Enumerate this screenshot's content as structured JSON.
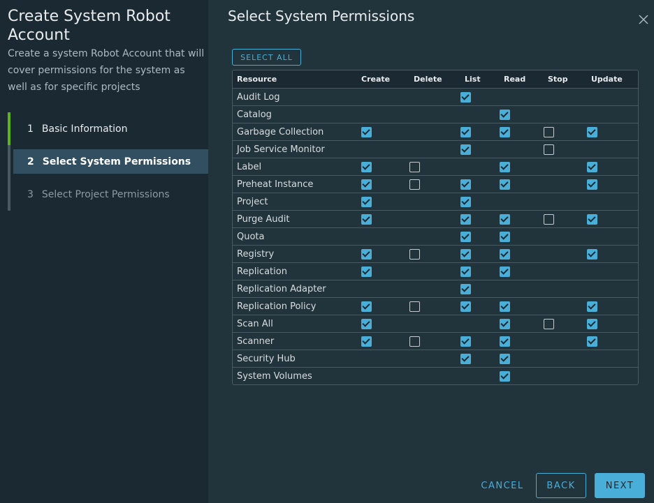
{
  "sidebar": {
    "title": "Create System Robot Account",
    "description": "Create a system Robot Account that will cover permissions for the system as well as for specific projects",
    "steps": [
      {
        "num": "1",
        "label": "Basic Information",
        "state": "done"
      },
      {
        "num": "2",
        "label": "Select System Permissions",
        "state": "active"
      },
      {
        "num": "3",
        "label": "Select Project Permissions",
        "state": "pending"
      }
    ]
  },
  "main": {
    "title": "Select System Permissions",
    "select_all_label": "SELECT ALL"
  },
  "table": {
    "headers": {
      "resource": "Resource",
      "create": "Create",
      "delete": "Delete",
      "list": "List",
      "read": "Read",
      "stop": "Stop",
      "update": "Update"
    },
    "rows": [
      {
        "resource": "Audit Log",
        "create": null,
        "delete": null,
        "list": true,
        "read": null,
        "stop": null,
        "update": null
      },
      {
        "resource": "Catalog",
        "create": null,
        "delete": null,
        "list": null,
        "read": true,
        "stop": null,
        "update": null
      },
      {
        "resource": "Garbage Collection",
        "create": true,
        "delete": null,
        "list": true,
        "read": true,
        "stop": false,
        "update": true
      },
      {
        "resource": "Job Service Monitor",
        "create": null,
        "delete": null,
        "list": true,
        "read": null,
        "stop": false,
        "update": null
      },
      {
        "resource": "Label",
        "create": true,
        "delete": false,
        "list": null,
        "read": true,
        "stop": null,
        "update": true
      },
      {
        "resource": "Preheat Instance",
        "create": true,
        "delete": false,
        "list": true,
        "read": true,
        "stop": null,
        "update": true
      },
      {
        "resource": "Project",
        "create": true,
        "delete": null,
        "list": true,
        "read": null,
        "stop": null,
        "update": null
      },
      {
        "resource": "Purge Audit",
        "create": true,
        "delete": null,
        "list": true,
        "read": true,
        "stop": false,
        "update": true
      },
      {
        "resource": "Quota",
        "create": null,
        "delete": null,
        "list": true,
        "read": true,
        "stop": null,
        "update": null
      },
      {
        "resource": "Registry",
        "create": true,
        "delete": false,
        "list": true,
        "read": true,
        "stop": null,
        "update": true
      },
      {
        "resource": "Replication",
        "create": true,
        "delete": null,
        "list": true,
        "read": true,
        "stop": null,
        "update": null
      },
      {
        "resource": "Replication Adapter",
        "create": null,
        "delete": null,
        "list": true,
        "read": null,
        "stop": null,
        "update": null
      },
      {
        "resource": "Replication Policy",
        "create": true,
        "delete": false,
        "list": true,
        "read": true,
        "stop": null,
        "update": true
      },
      {
        "resource": "Scan All",
        "create": true,
        "delete": null,
        "list": null,
        "read": true,
        "stop": false,
        "update": true
      },
      {
        "resource": "Scanner",
        "create": true,
        "delete": false,
        "list": true,
        "read": true,
        "stop": null,
        "update": true
      },
      {
        "resource": "Security Hub",
        "create": null,
        "delete": null,
        "list": true,
        "read": true,
        "stop": null,
        "update": null
      },
      {
        "resource": "System Volumes",
        "create": null,
        "delete": null,
        "list": null,
        "read": true,
        "stop": null,
        "update": null
      }
    ]
  },
  "footer": {
    "cancel_label": "CANCEL",
    "back_label": "BACK",
    "next_label": "NEXT"
  },
  "colors": {
    "accent": "#49afd9",
    "step_done": "#60b515",
    "active_step_bg": "#324f61"
  }
}
